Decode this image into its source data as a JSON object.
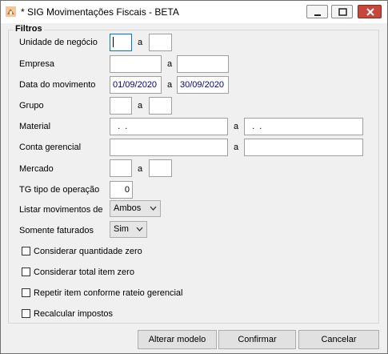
{
  "window": {
    "title": "* SIG Movimentações Fiscais - BETA"
  },
  "filters": {
    "legend": "Filtros",
    "separator": "a",
    "unidade_negocio": {
      "label": "Unidade de negócio",
      "from": "",
      "to": ""
    },
    "empresa": {
      "label": "Empresa",
      "from": "",
      "to": ""
    },
    "data_movimento": {
      "label": "Data do movimento",
      "from": "01/09/2020",
      "to": "30/09/2020"
    },
    "grupo": {
      "label": "Grupo",
      "from": "",
      "to": ""
    },
    "material": {
      "label": "Material",
      "from": "  .  .",
      "to": "  .  ."
    },
    "conta_gerencial": {
      "label": "Conta gerencial",
      "from": "",
      "to": ""
    },
    "mercado": {
      "label": "Mercado",
      "from": "",
      "to": ""
    },
    "tg_tipo_operacao": {
      "label": "TG tipo de operação",
      "value": "0"
    },
    "listar_movimentos": {
      "label": "Listar movimentos de",
      "selected": "Ambos"
    },
    "somente_faturados": {
      "label": "Somente faturados",
      "selected": "Sim"
    }
  },
  "checkboxes": [
    {
      "label": "Considerar quantidade zero",
      "checked": false
    },
    {
      "label": "Considerar total item zero",
      "checked": false
    },
    {
      "label": "Repetir item conforme rateio gerencial",
      "checked": false
    },
    {
      "label": "Recalcular impostos",
      "checked": false
    }
  ],
  "buttons": {
    "alterar_modelo": "Alterar modelo",
    "confirmar": "Confirmar",
    "cancelar": "Cancelar"
  },
  "colors": {
    "date_text": "#00007f",
    "close_button": "#c7473a",
    "focus_border": "#0078d7"
  }
}
